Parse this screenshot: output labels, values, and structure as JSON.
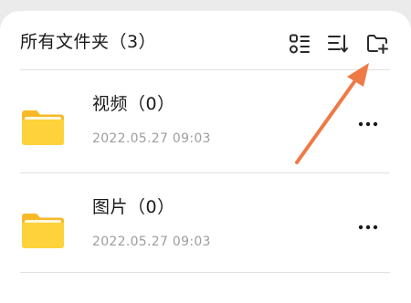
{
  "header": {
    "title": "所有文件夹（3）",
    "actions": [
      {
        "name": "view-toggle",
        "icon": "grid-list-icon"
      },
      {
        "name": "sort",
        "icon": "sort-icon"
      },
      {
        "name": "new-folder",
        "icon": "folder-add-icon"
      }
    ]
  },
  "folders": [
    {
      "name": "视频（0）",
      "date": "2022.05.27 09:03",
      "icon": "folder-icon"
    },
    {
      "name": "图片（0）",
      "date": "2022.05.27 09:03",
      "icon": "folder-icon"
    }
  ],
  "colors": {
    "folder_body": "#fdd23b",
    "folder_tab": "#f7b928",
    "folder_paper": "#fff7dc",
    "arrow": "#ef7a45",
    "text_primary": "#1a1a1a",
    "text_secondary": "#9e9e9e"
  }
}
